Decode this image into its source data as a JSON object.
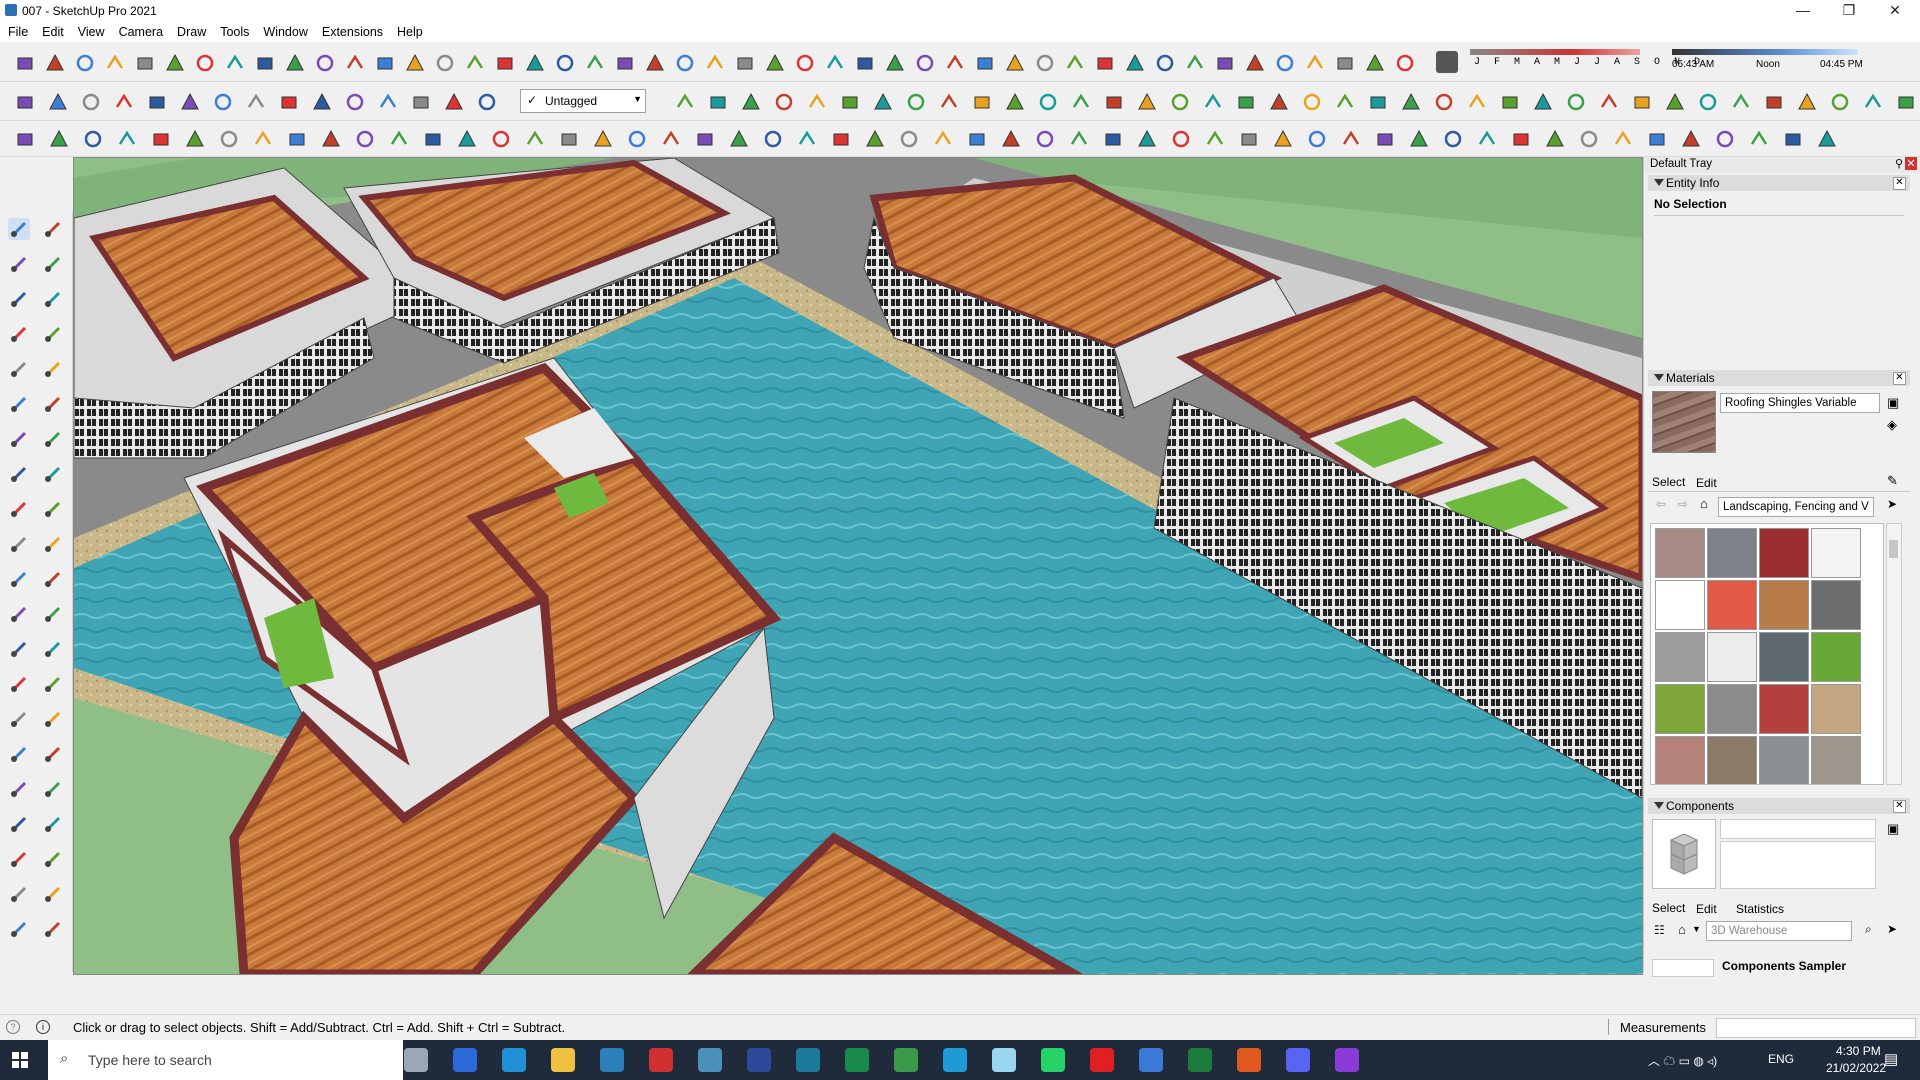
{
  "window": {
    "title": "007 - SketchUp Pro 2021",
    "minimize": "—",
    "maximize": "❐",
    "close": "✕"
  },
  "menu": [
    "File",
    "Edit",
    "View",
    "Camera",
    "Draw",
    "Tools",
    "Window",
    "Extensions",
    "Help"
  ],
  "shadow": {
    "months": "J F M A M J J A S O N D",
    "time_start": "06:43 AM",
    "time_mid": "Noon",
    "time_end": "04:45 PM"
  },
  "tag_dropdown": {
    "value": "Untagged"
  },
  "tray": {
    "title": "Default Tray",
    "entity_info": {
      "header": "Entity Info",
      "status": "No Selection"
    },
    "materials": {
      "header": "Materials",
      "name": "Roofing Shingles Variable",
      "tabs": [
        "Select",
        "Edit"
      ],
      "library": "Landscaping, Fencing and V",
      "swatch_colors": [
        "#a88a84",
        "#7d8389",
        "#9b2e30",
        "#f3f3f3",
        "#ffffff",
        "#e25a45",
        "#b87b4a",
        "#6d6d6d",
        "#9c9c9c",
        "#ececec",
        "#5f6a6f",
        "#67a836",
        "#7ea63a",
        "#8c8c8c",
        "#b3403d",
        "#c4a581",
        "#b48279",
        "#8a7a67",
        "#8c8f91",
        "#9d968c"
      ]
    },
    "components": {
      "header": "Components",
      "tabs": [
        "Select",
        "Edit",
        "Statistics"
      ],
      "search_placeholder": "3D Warehouse",
      "sampler": "Components Sampler"
    }
  },
  "status": {
    "hint": "Click or drag to select objects. Shift = Add/Subtract. Ctrl = Add. Shift + Ctrl = Subtract.",
    "measurements_label": "Measurements"
  },
  "taskbar": {
    "search_placeholder": "Type here to search",
    "lang": "ENG",
    "time": "4:30 PM",
    "date": "21/02/2022"
  }
}
